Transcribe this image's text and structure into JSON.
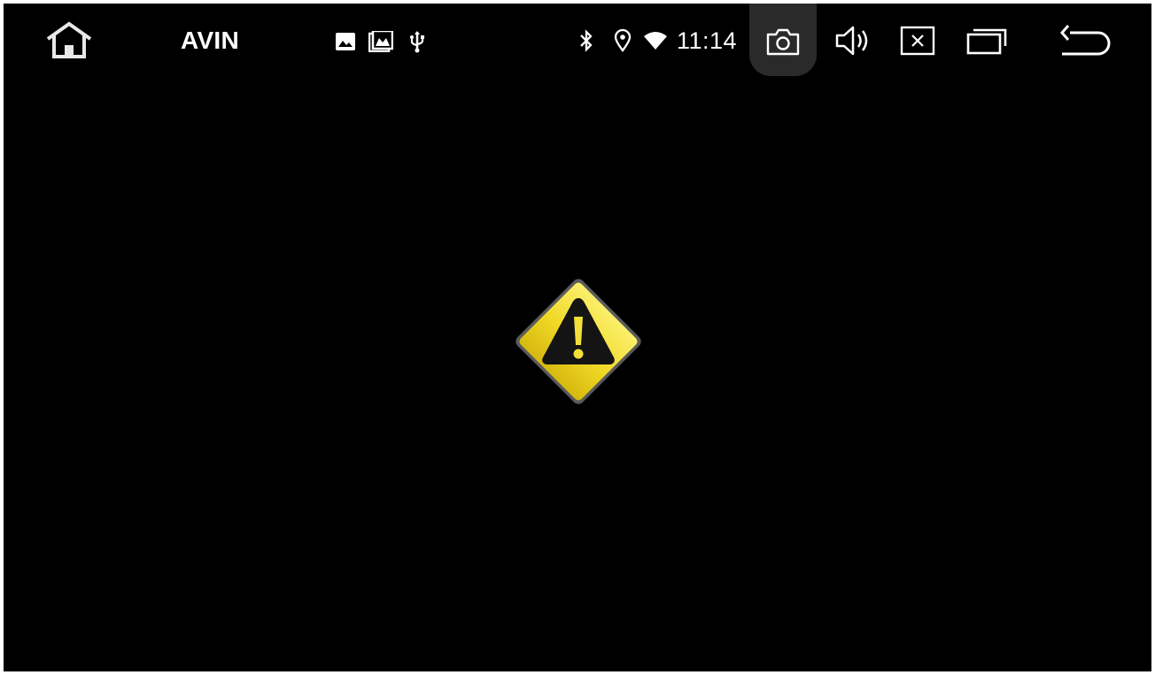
{
  "statusbar": {
    "app_title": "AVIN",
    "time": "11:14",
    "left_icons": [
      "home-icon"
    ],
    "notification_icons": [
      "photo-icon",
      "gallery-icon",
      "usb-icon"
    ],
    "system_icons": [
      "bluetooth-icon",
      "location-icon",
      "wifi-icon"
    ],
    "action_icons": [
      "screenshot-camera-icon",
      "volume-icon",
      "close-app-icon",
      "recent-apps-icon",
      "back-icon"
    ]
  },
  "main": {
    "status_icon": "warning-icon"
  },
  "colors": {
    "background": "#000000",
    "icon": "#ffffff",
    "warning_yellow": "#f3df3a",
    "camera_highlight": "#2a2a2a"
  }
}
